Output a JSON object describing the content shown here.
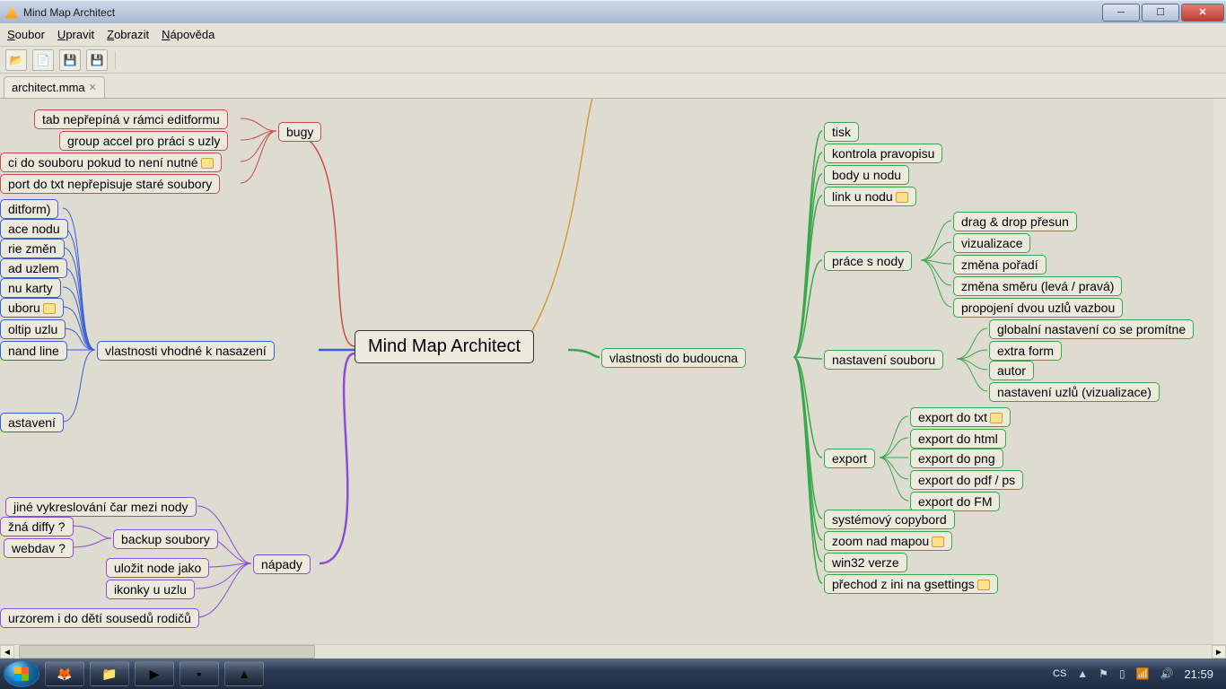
{
  "window": {
    "title": "Mind Map Architect"
  },
  "menu": {
    "file": "Soubor",
    "edit": "Upravit",
    "view": "Zobrazit",
    "help": "Nápověda"
  },
  "tab": {
    "name": "architect.mma"
  },
  "nodes": {
    "root": "Mind Map Architect",
    "bugy": "bugy",
    "bug1": "tab nepřepíná v rámci editformu",
    "bug2": "group accel pro práci s uzly",
    "bug3": "ci do souboru pokud to není nutné",
    "bug4": "port do txt nepřepisuje staré soubory",
    "vlast": "vlastnosti vhodné k nasazení",
    "v1": "ditform)",
    "v2": "ace nodu",
    "v3": "rie změn",
    "v4": "ad uzlem",
    "v5": "nu karty",
    "v6": "uboru",
    "v7": "oltip uzlu",
    "v8": "nand line",
    "v9": "astavení",
    "napady": "nápady",
    "n1": "jiné vykreslování čar mezi nody",
    "n2": "žná diffy ?",
    "n3": "webdav ?",
    "n4": "backup soubory",
    "n5": "uložit node jako",
    "n6": "ikonky u uzlu",
    "n7": "urzorem i do dětí sousedů rodičů",
    "future": "vlastnosti do budoucna",
    "f1": "tisk",
    "f2": "kontrola pravopisu",
    "f3": "body u nodu",
    "f4": "link u nodu",
    "prace": "práce s nody",
    "p1": "drag & drop přesun",
    "p2": "vizualizace",
    "p3": "změna pořadí",
    "p4": "změna směru (levá / pravá)",
    "p5": "propojení dvou uzlů vazbou",
    "nast": "nastavení souboru",
    "ns1": "globalní nastavení co se promítne",
    "ns2": "extra form",
    "ns3": "autor",
    "ns4": "nastavení uzlů (vizualizace)",
    "export": "export",
    "e1": "export do txt",
    "e2": "export do html",
    "e3": "export do png",
    "e4": "export do pdf / ps",
    "e5": "export do FM",
    "f5": "systémový copybord",
    "f6": "zoom nad mapou",
    "f7": "win32 verze",
    "f8": "přechod z ini na gsettings"
  },
  "tray": {
    "lang": "CS",
    "clock": "21:59"
  }
}
